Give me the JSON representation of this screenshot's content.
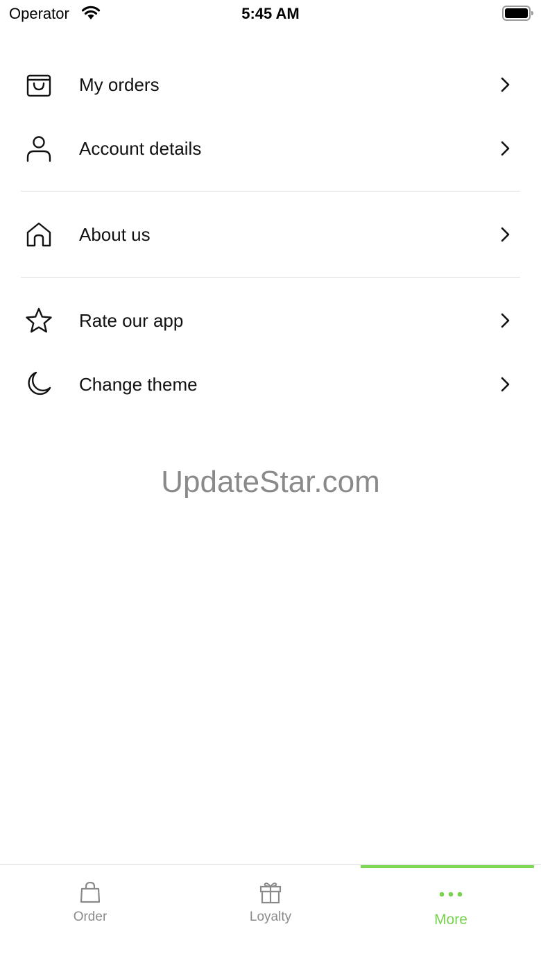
{
  "status_bar": {
    "carrier": "Operator",
    "time": "5:45 AM"
  },
  "menu": {
    "items": [
      {
        "label": "My orders",
        "icon": "shopping-bag-icon"
      },
      {
        "label": "Account details",
        "icon": "person-icon"
      },
      {
        "label": "About us",
        "icon": "home-icon"
      },
      {
        "label": "Rate our app",
        "icon": "star-icon"
      },
      {
        "label": "Change theme",
        "icon": "moon-icon"
      }
    ]
  },
  "watermark": "UpdateStar.com",
  "tab_bar": {
    "active_tab": "More",
    "accent_color": "#7ed957",
    "tabs": [
      {
        "label": "Order",
        "icon": "bag-icon"
      },
      {
        "label": "Loyalty",
        "icon": "gift-icon"
      },
      {
        "label": "More",
        "icon": "more-dots-icon"
      }
    ]
  }
}
